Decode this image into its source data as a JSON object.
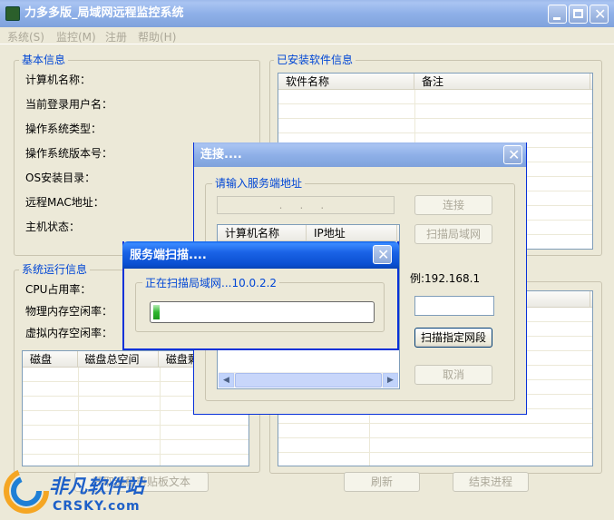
{
  "main_window": {
    "title": "力多多版_局域网远程监控系统",
    "menu": [
      "系统(S)",
      "监控(M)",
      "注册",
      "帮助(H)"
    ],
    "basic_info": {
      "title": "基本信息",
      "labels": [
        "计算机名称：",
        "当前登录用户名：",
        "操作系统类型：",
        "操作系统版本号：",
        "OS安装目录：",
        "远程MAC地址：",
        "主机状态："
      ]
    },
    "software": {
      "title": "已安装软件信息",
      "columns": [
        "软件名称",
        "备注"
      ]
    },
    "runtime": {
      "title": "系统运行信息",
      "labels": [
        "CPU占用率：",
        "物理内存空闲率：",
        "虚拟内存空闲率："
      ],
      "disk_columns": [
        "磁盘",
        "磁盘总空间",
        "磁盘剩"
      ]
    },
    "clipboard_button": "获取远程剪贴板文本",
    "refresh_button": "刷新",
    "end_process_button": "结束进程"
  },
  "connect_dialog": {
    "title": "连接....",
    "group_title": "请输入服务端地址",
    "ip_placeholder": "  .     .     .",
    "connect_button": "连接",
    "scan_lan_button": "扫描局域网",
    "list_columns": [
      "计算机名称",
      "IP地址"
    ],
    "example_text": "例:192.168.1",
    "scan_segment_button": "扫描指定网段",
    "cancel_button": "取消"
  },
  "scan_dialog": {
    "title": "服务端扫描....",
    "group_title": "正在扫描局域网...10.0.2.2",
    "progress": 0.03
  },
  "watermark": {
    "brand": "非凡软件站",
    "site": "CRSKY.com"
  },
  "colors": {
    "titlebar": "#0a4fd1",
    "group_title": "#0046d5",
    "progress": "#2fb62f"
  }
}
